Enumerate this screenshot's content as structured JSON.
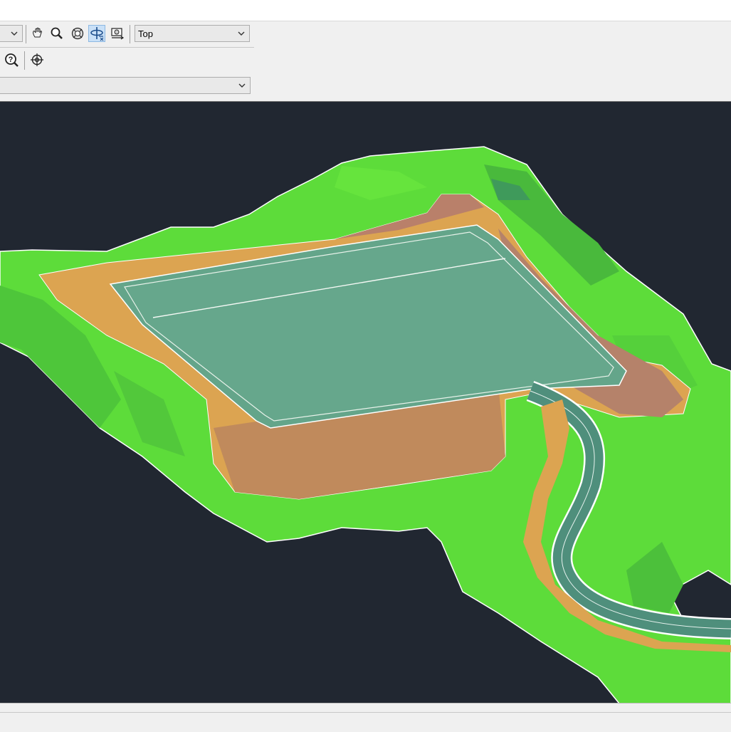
{
  "toolbar": {
    "left_combo_value": "",
    "view_combo_value": "Top",
    "style_combo_value": "",
    "buttons": {
      "pan": "pan-icon",
      "zoom": "zoom-icon",
      "orbit": "orbit-icon",
      "free_orbit": "free-orbit-icon",
      "camera": "camera-icon",
      "help": "help-icon",
      "target": "target-icon"
    }
  },
  "viewport": {
    "background": "#212731",
    "colors": {
      "terrain_green": "#5fdc3a",
      "terrain_dark_green": "#47b83a",
      "embankment": "#dca451",
      "embankment_shadow": "#b88560",
      "pond_surface": "#64a58a",
      "road": "#4f8f7c",
      "outline": "#ffffff"
    }
  }
}
